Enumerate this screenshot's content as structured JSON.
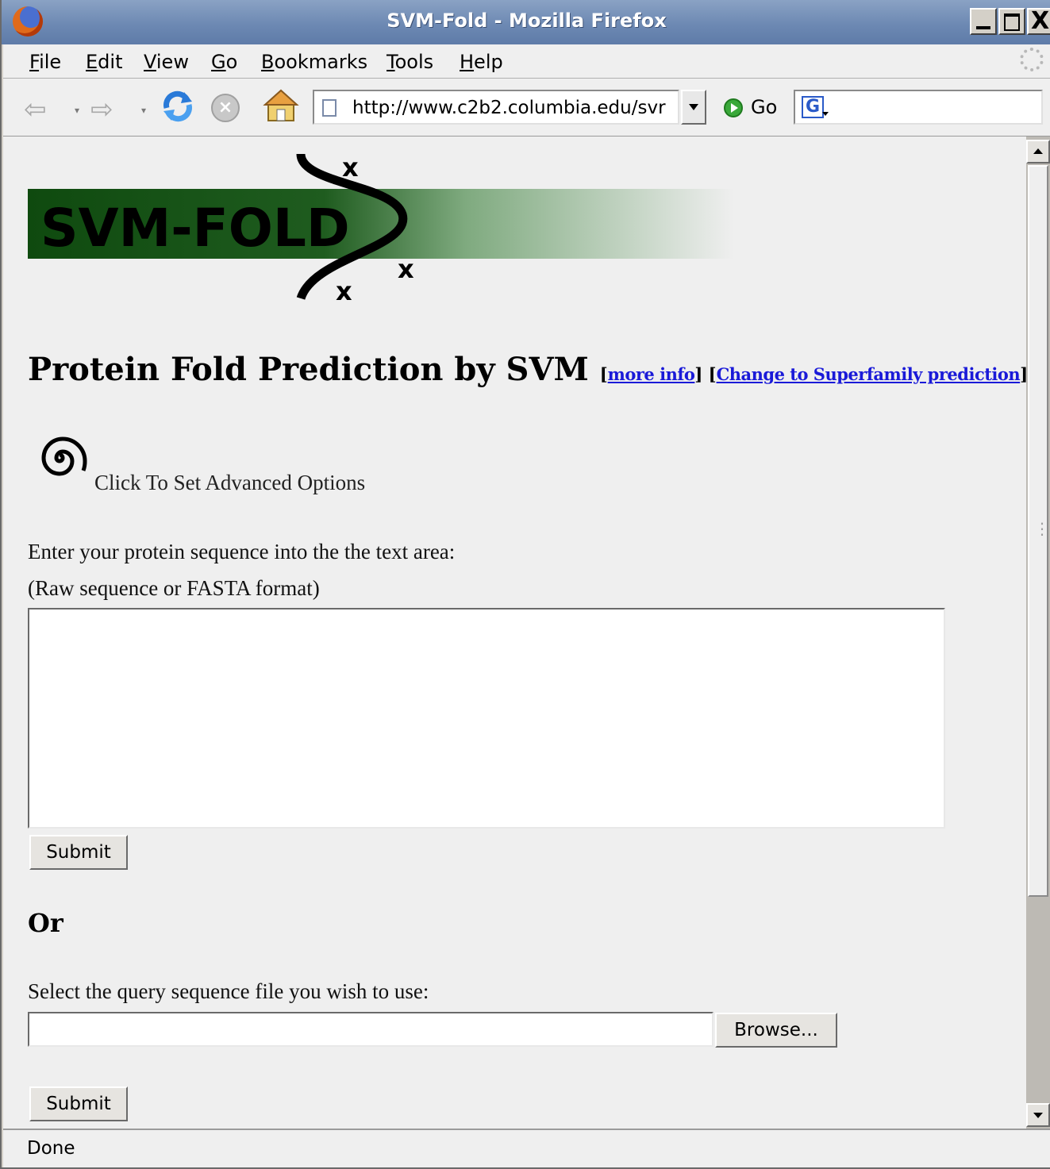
{
  "window": {
    "title": "SVM-Fold - Mozilla Firefox",
    "close_glyph": "X"
  },
  "menubar": {
    "items": [
      {
        "accel": "F",
        "rest": "ile"
      },
      {
        "accel": "E",
        "rest": "dit"
      },
      {
        "accel": "V",
        "rest": "iew"
      },
      {
        "accel": "G",
        "rest": "o"
      },
      {
        "accel": "B",
        "rest": "ookmarks"
      },
      {
        "accel": "T",
        "rest": "ools"
      },
      {
        "accel": "H",
        "rest": "elp"
      }
    ]
  },
  "toolbar": {
    "url": "http://www.c2b2.columbia.edu/svr",
    "go_label": "Go",
    "search_placeholder": "",
    "search_engine_letter": "G"
  },
  "page": {
    "logo_text": "SVM-FOLD",
    "logo_mark": "x",
    "heading": "Protein Fold Prediction by SVM",
    "link_more_info": "more info",
    "link_superfamily": "Change to Superfamily prediction",
    "advanced_options_label": "Click To Set Advanced Options",
    "instruction_line1": "Enter your protein sequence into the the text area:",
    "instruction_line2": "(Raw sequence or FASTA format)",
    "sequence_value": "",
    "submit_label": "Submit",
    "or_heading": "Or",
    "file_instruction": "Select the query sequence file you wish to use:",
    "file_value": "",
    "browse_label": "Browse...",
    "submit2_label": "Submit"
  },
  "statusbar": {
    "text": "Done"
  },
  "colors": {
    "logo_green_dark": "#0f4a0f",
    "logo_green_mid": "#6f9f6f",
    "link_blue": "#1a1ad8",
    "titlebar": "#6d89b3"
  }
}
